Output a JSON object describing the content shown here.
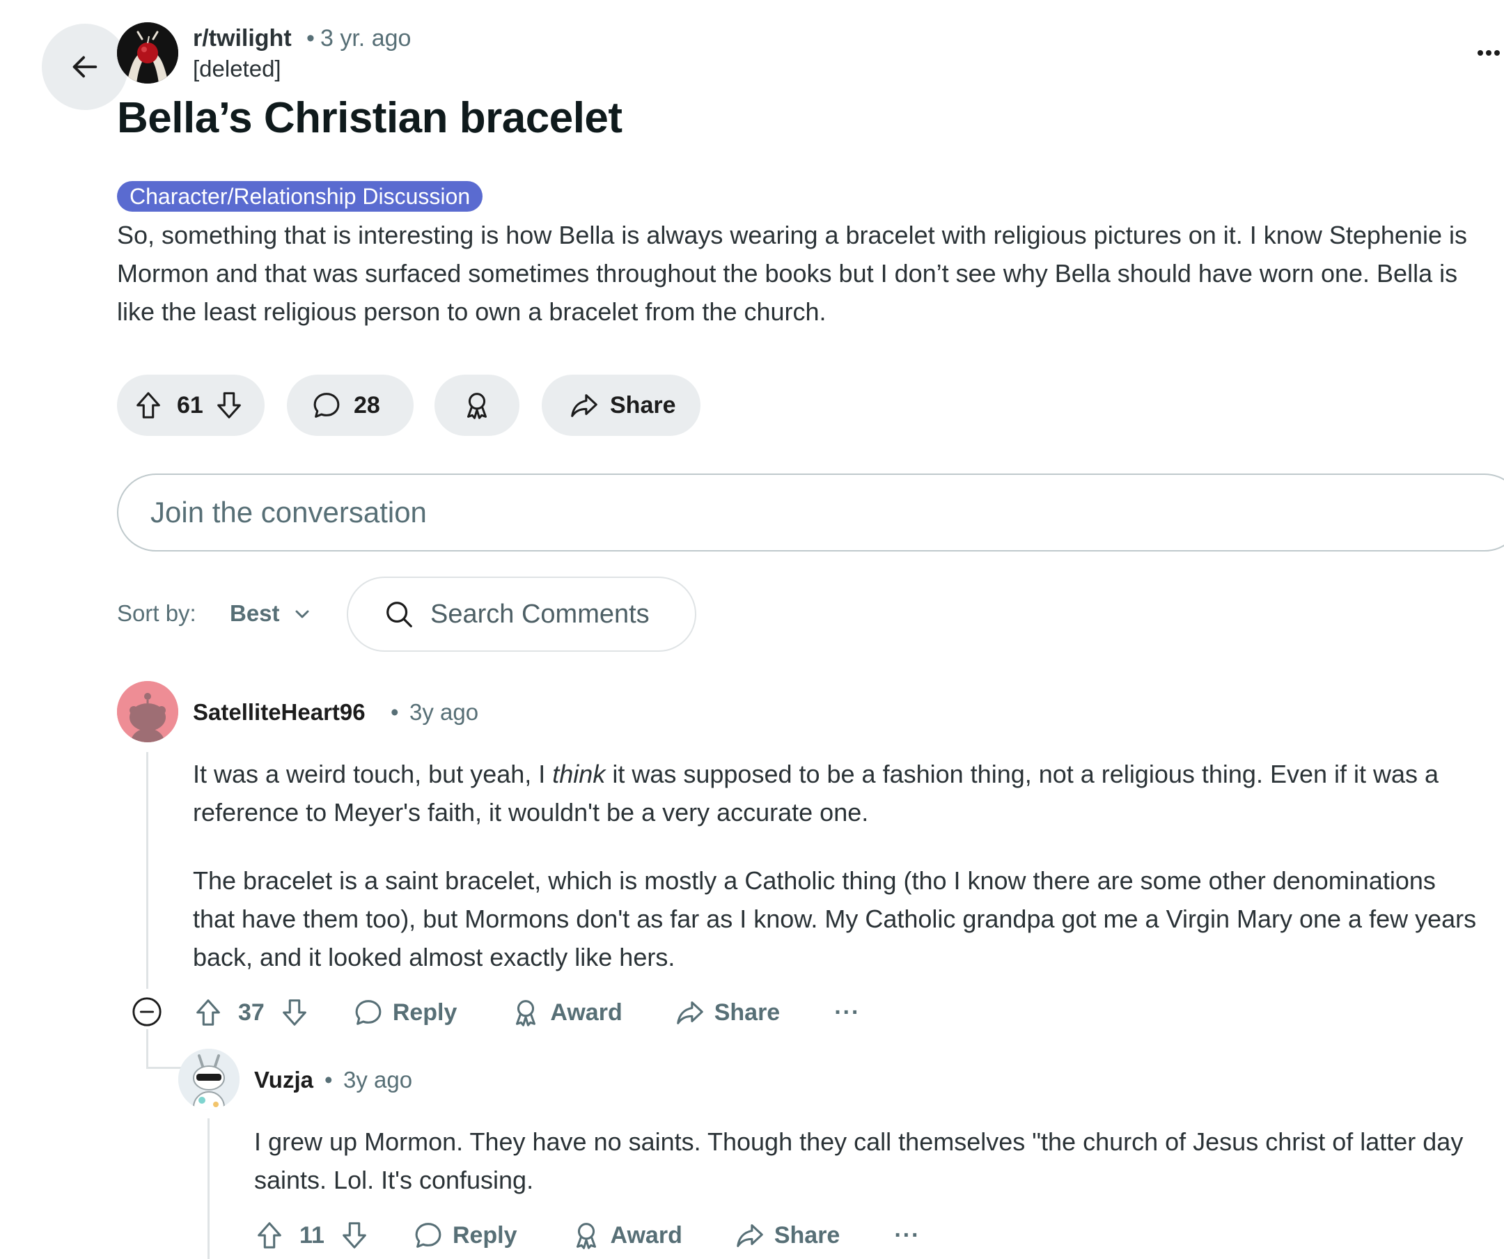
{
  "post": {
    "subreddit": "r/twilight",
    "separator": "•",
    "age": "3 yr. ago",
    "author": "[deleted]",
    "title": "Bella’s Christian bracelet",
    "flair": "Character/Relationship Discussion",
    "body": "So, something that is interesting is how Bella is always wearing a bracelet with religious pictures on it. I know Stephenie is Mormon and that was surfaced sometimes throughout the books but I don’t see why Bella should have worn one. Bella is like the least religious person to own a bracelet from the church.",
    "score": "61",
    "comment_count": "28",
    "share_label": "Share"
  },
  "composer": {
    "placeholder": "Join the conversation"
  },
  "sort": {
    "label": "Sort by:",
    "value": "Best"
  },
  "search": {
    "placeholder": "Search Comments"
  },
  "comments": [
    {
      "username": "SatelliteHeart96",
      "separator": "•",
      "age": "3y ago",
      "p1_before": "It was a weird touch, but yeah, I ",
      "p1_em": "think",
      "p1_after": " it was supposed to be a fashion thing, not a religious thing. Even if it was a reference to Meyer's faith, it wouldn't be a very accurate one.",
      "p2": "The bracelet is a saint bracelet, which is mostly a Catholic thing (tho I know there are some other denominations that have them too), but Mormons don't as far as I know. My Catholic grandpa got me a Virgin Mary one a few years back, and it looked almost exactly like hers.",
      "score": "37",
      "reply_label": "Reply",
      "award_label": "Award",
      "share_label": "Share",
      "more": "···"
    },
    {
      "username": "Vuzja",
      "separator": "•",
      "age": "3y ago",
      "body": "I grew up Mormon. They have no saints. Though they call themselves \"the church of Jesus christ of latter day saints. Lol. It's confusing.",
      "score": "11",
      "reply_label": "Reply",
      "award_label": "Award",
      "share_label": "Share",
      "more": "···"
    }
  ],
  "colors": {
    "flair_bg": "#5a6bd0",
    "pill_bg": "#eaedef",
    "muted_text": "#576f76",
    "avatar_pink": "#ee8d95"
  }
}
